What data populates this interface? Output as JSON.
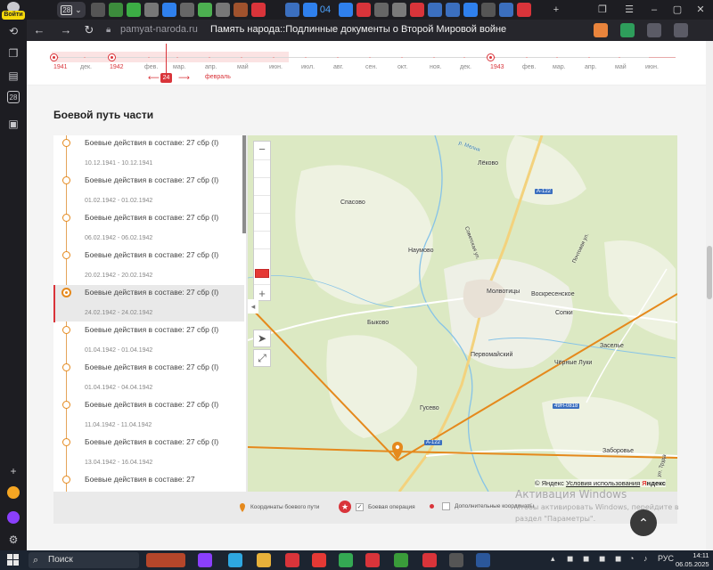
{
  "browser": {
    "signin_label": "Войти",
    "active_tab_count": "28",
    "url": "pamyat-naroda.ru",
    "page_title": "Память народа::Подлинные документы о Второй Мировой войне",
    "tab_group_counter": "04",
    "sidebar_badge": "28"
  },
  "timeline": {
    "labels": [
      "1941",
      "дек.",
      "1942",
      "фев.",
      "мар.",
      "апр.",
      "май",
      "июн.",
      "июл.",
      "авг.",
      "сен.",
      "окт.",
      "ноя.",
      "дек.",
      "1943",
      "фев.",
      "мар.",
      "апр.",
      "май",
      "июн."
    ],
    "current_day": "24",
    "current_month": "февраль",
    "prev_arrow": "⟵",
    "next_arrow": "⟶"
  },
  "section": {
    "title": "Боевой путь части"
  },
  "entries": [
    {
      "title": "Боевые действия в составе: 27 сбр (I)",
      "dates": "10.12.1941 - 10.12.1941"
    },
    {
      "title": "Боевые действия в составе: 27 сбр (I)",
      "dates": "01.02.1942 - 01.02.1942"
    },
    {
      "title": "Боевые действия в составе: 27 сбр (I)",
      "dates": "06.02.1942 - 06.02.1942"
    },
    {
      "title": "Боевые действия в составе: 27 сбр (I)",
      "dates": "20.02.1942 - 20.02.1942"
    },
    {
      "title": "Боевые действия в составе: 27 сбр (I)",
      "dates": "24.02.1942 - 24.02.1942"
    },
    {
      "title": "Боевые действия в составе: 27 сбр (I)",
      "dates": "01.04.1942 - 01.04.1942"
    },
    {
      "title": "Боевые действия в составе: 27 сбр (I)",
      "dates": "01.04.1942 - 04.04.1942"
    },
    {
      "title": "Боевые действия в составе: 27 сбр (I)",
      "dates": "11.04.1942 - 11.04.1942"
    },
    {
      "title": "Боевые действия в составе: 27 сбр (I)",
      "dates": "13.04.1942 - 16.04.1942"
    },
    {
      "title": "Боевые действия в составе: 27",
      "dates": ""
    }
  ],
  "map": {
    "places": {
      "lyokovo": "Лёково",
      "spasovo": "Спасово",
      "naumovo": "Наумово",
      "molvotitsy": "Молвотицы",
      "voskresenskoe": "Воскресенское",
      "sopki": "Сопки",
      "bykovo": "Быково",
      "pervomaysky": "Первомайский",
      "zasele": "Заселье",
      "chernye_luki": "Чёрные Луки",
      "gusevo": "Гусево",
      "zaborovye": "Заборовье",
      "melnaya": "р. Мелня",
      "sovetskaya": "Советская ул.",
      "pochtovaya": "Почтовая ул.",
      "trudovaya": "ул. Труда"
    },
    "roads": {
      "a122_top": "А-122",
      "a122_bottom": "А-122",
      "r49": "49Н-0818"
    },
    "copyright_prefix": "© Яндекс",
    "copyright_link": "Условия использования",
    "brand_left": "Я",
    "brand_right": "ндекс"
  },
  "legend": {
    "path_coords": "Координаты боевого пути",
    "combat_op": "Боевая операция",
    "extra_coords": "Дополнительные координаты"
  },
  "activation": {
    "heading": "Активация Windows",
    "line1": "Чтобы активировать Windows, перейдите в",
    "line2": "раздел \"Параметры\"."
  },
  "taskbar": {
    "search_label": "Поиск",
    "lang": "РУС",
    "time": "14:11",
    "date": "06.05.2025"
  },
  "colors": {
    "accent_red": "#d9343a",
    "route_orange": "#e5891c",
    "map_green": "#dce9c3"
  }
}
